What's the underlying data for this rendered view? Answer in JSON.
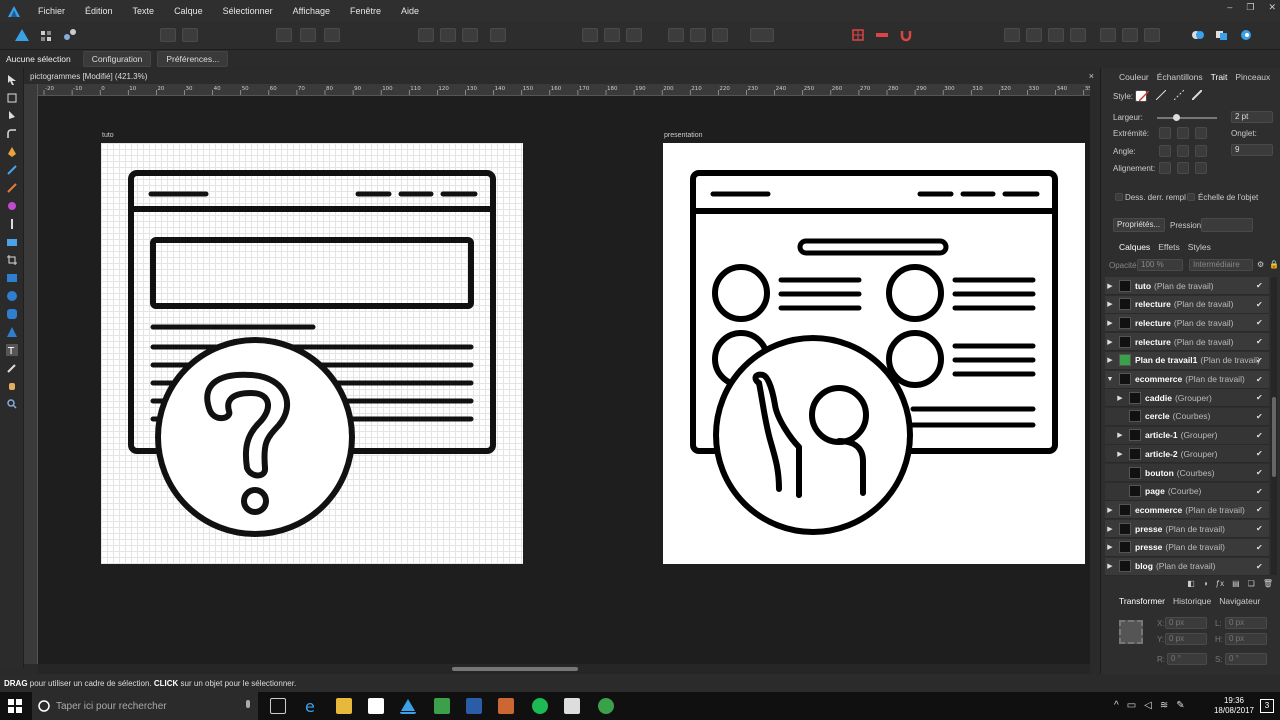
{
  "menu": [
    "Fichier",
    "Édition",
    "Texte",
    "Calque",
    "Sélectionner",
    "Affichage",
    "Fenêtre",
    "Aide"
  ],
  "context_bar": {
    "selection": "Aucune sélection",
    "configuration": "Configuration",
    "preferences": "Préférences..."
  },
  "document": {
    "title": "pictogrammes [Modifié] (421.3%)",
    "close": "×"
  },
  "ruler": {
    "ticks": [
      "-20",
      "-10",
      "0",
      "10",
      "20",
      "30",
      "40",
      "50",
      "60",
      "70",
      "80",
      "90",
      "100",
      "110",
      "120",
      "130",
      "140",
      "150",
      "160",
      "170",
      "180",
      "190",
      "200",
      "210",
      "220",
      "230",
      "240",
      "250",
      "260",
      "270",
      "280",
      "290",
      "300",
      "310",
      "320",
      "330",
      "340",
      "350"
    ]
  },
  "artboards": [
    {
      "label": "tuto"
    },
    {
      "label": "presentation"
    }
  ],
  "right_panel": {
    "top_tabs": [
      "Couleur",
      "Échantillons",
      "Trait",
      "Pinceaux"
    ],
    "active_top_tab": "Trait",
    "style_label": "Style:",
    "largeur_label": "Largeur:",
    "largeur_value": "2 pt",
    "extremite_label": "Extrémité:",
    "onglet_label": "Onglet:",
    "onglet_value": "9",
    "angle_label": "Angle:",
    "alignement_label": "Alignement:",
    "dess_derr": "Dess. derr. rempl",
    "echelle_objet": "Échelle de l'objet",
    "proprietes": "Propriétés...",
    "pression": "Pression:",
    "layer_tabs": [
      "Calques",
      "Effets",
      "Styles"
    ],
    "active_layer_tab": "Calques",
    "opacite_label": "Opacité:",
    "opacite_value": "100 %",
    "blend_value": "Intermédiaire",
    "layers": [
      {
        "name": "tuto",
        "type": "(Plan de travail)",
        "level": 0,
        "expander": "▶"
      },
      {
        "name": "relecture",
        "type": "(Plan de travail)",
        "level": 0,
        "expander": "▶"
      },
      {
        "name": "relecture",
        "type": "(Plan de travail)",
        "level": 0,
        "expander": "▶"
      },
      {
        "name": "relecture",
        "type": "(Plan de travail)",
        "level": 0,
        "expander": "▶"
      },
      {
        "name": "Plan de travail1",
        "type": "(Plan de travail)",
        "level": 0,
        "expander": "▶"
      },
      {
        "name": "ecommerce",
        "type": "(Plan de travail)",
        "level": 0,
        "expander": "▼"
      },
      {
        "name": "caddie",
        "type": "(Grouper)",
        "level": 1,
        "expander": "▶"
      },
      {
        "name": "cercle",
        "type": "(Courbes)",
        "level": 1,
        "expander": ""
      },
      {
        "name": "article-1",
        "type": "(Grouper)",
        "level": 1,
        "expander": "▶"
      },
      {
        "name": "article-2",
        "type": "(Grouper)",
        "level": 1,
        "expander": "▶"
      },
      {
        "name": "bouton",
        "type": "(Courbes)",
        "level": 1,
        "expander": ""
      },
      {
        "name": "page",
        "type": "(Courbe)",
        "level": 1,
        "expander": ""
      },
      {
        "name": "ecommerce",
        "type": "(Plan de travail)",
        "level": 0,
        "expander": "▶"
      },
      {
        "name": "presse",
        "type": "(Plan de travail)",
        "level": 0,
        "expander": "▶"
      },
      {
        "name": "presse",
        "type": "(Plan de travail)",
        "level": 0,
        "expander": "▶"
      },
      {
        "name": "blog",
        "type": "(Plan de travail)",
        "level": 0,
        "expander": "▶"
      }
    ],
    "bottom_tabs": [
      "Transformer",
      "Historique",
      "Navigateur"
    ],
    "active_bottom_tab": "Transformer",
    "transform": {
      "x_label": "X:",
      "x_value": "0 px",
      "y_label": "Y:",
      "y_value": "0 px",
      "l_label": "L:",
      "l_value": "0 px",
      "h_label": "H:",
      "h_value": "0 px",
      "r_label": "R:",
      "r_value": "0 °",
      "s_label": "S:",
      "s_value": "0 °"
    }
  },
  "status": {
    "drag": "DRAG",
    "drag_text": " pour utiliser un cadre de sélection. ",
    "click": "CLICK",
    "click_text": " sur un objet pour le sélectionner."
  },
  "taskbar": {
    "search_placeholder": "Taper ici pour rechercher",
    "time": "19:36",
    "date": "18/08/2017",
    "notifications": "3"
  },
  "colors": {
    "accent": "#2f7fd0",
    "menubar": "#2f2f2f",
    "canvas": "#1e1e1e",
    "panel": "#2e2e2e"
  }
}
